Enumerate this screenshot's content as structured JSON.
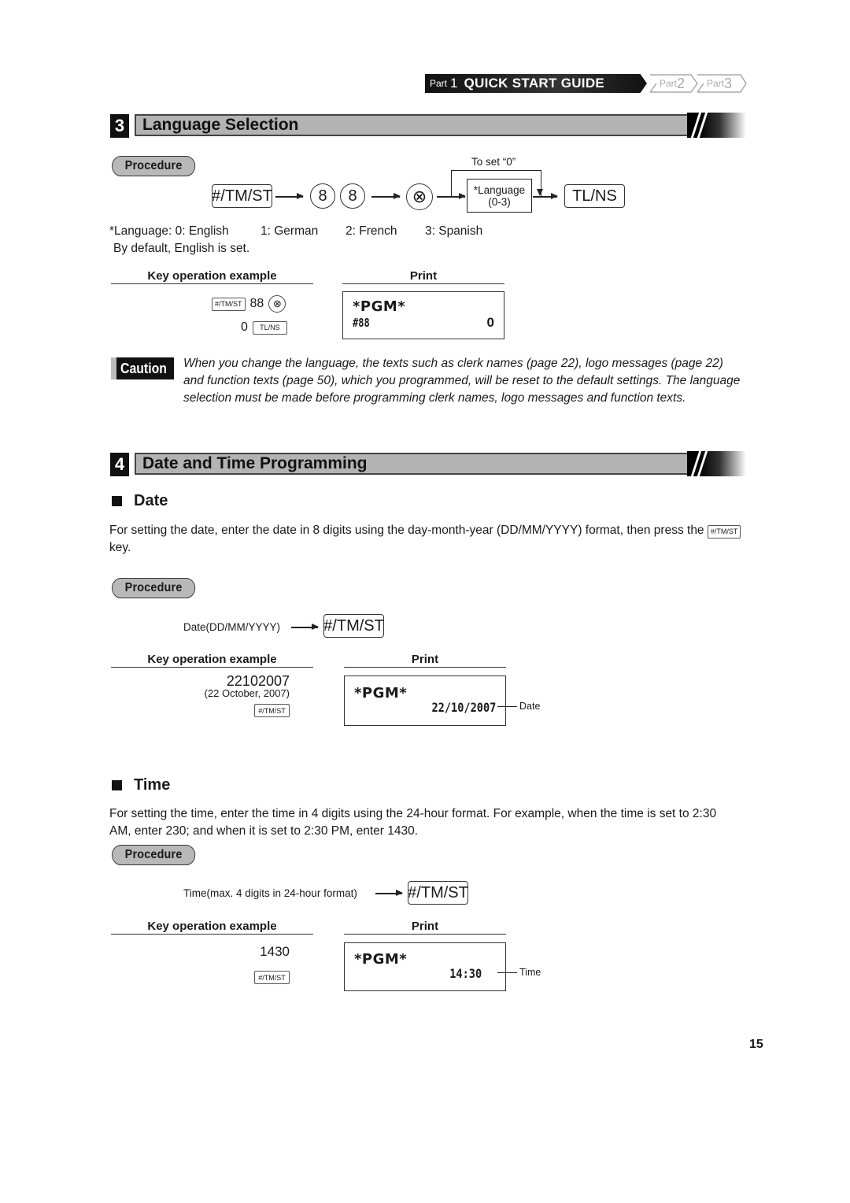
{
  "header": {
    "part1_prefix": "Part",
    "part1_num": "1",
    "part1_title": "QUICK START GUIDE",
    "part2_prefix": "Part",
    "part2_num": "2",
    "part3_prefix": "Part",
    "part3_num": "3"
  },
  "section3": {
    "number": "3",
    "title": "Language Selection",
    "procedure_label": "Procedure",
    "flow": {
      "key1": "#/TM/ST",
      "digit1": "8",
      "digit2": "8",
      "multiply_key": "⊗",
      "to_set_label": "To set “0”",
      "language_box_line1": "*Language",
      "language_box_line2": "(0-3)",
      "final_key": "TL/NS"
    },
    "language_options": [
      "*Language: 0: English",
      "1: German",
      "2: French",
      "3: Spanish"
    ],
    "default_note": "By default, English is set.",
    "key_op_header": "Key operation example",
    "print_header": "Print",
    "key_op": {
      "line1_key": "#/TM/ST",
      "line1_digits": "88",
      "line1_mult": "⊗",
      "line2_digit": "0",
      "line2_key": "TL/NS"
    },
    "print": {
      "pgm": "*PGM*",
      "code": "#88",
      "value": "0"
    },
    "caution_label": "Caution",
    "caution_text": "When you change the language, the texts such as clerk names (page 22), logo messages (page 22) and function texts (page 50), which you programmed, will be reset to the default settings.  The language selection must be made before programming clerk names, logo messages and function texts."
  },
  "section4": {
    "number": "4",
    "title": "Date and Time Programming",
    "date": {
      "title": "Date",
      "description": "For setting the date, enter the date in 8 digits using the day-month-year (DD/MM/YYYY) format, then press the",
      "description_key": "#/TM/ST",
      "description_end": "key.",
      "procedure_label": "Procedure",
      "flow_label": "Date(DD/MM/YYYY)",
      "flow_key": "#/TM/ST",
      "key_op_header": "Key operation example",
      "print_header": "Print",
      "example_value": "22102007",
      "example_note": "(22 October, 2007)",
      "example_key": "#/TM/ST",
      "print_pgm": "*PGM*",
      "print_value": "22/10/2007",
      "print_callout": "Date"
    },
    "time": {
      "title": "Time",
      "description": "For setting the time, enter the time in 4 digits using the 24-hour format.  For example, when the time is set to 2:30 AM, enter 230; and when it is set to 2:30 PM, enter 1430.",
      "procedure_label": "Procedure",
      "flow_label": "Time(max. 4 digits in 24-hour format)",
      "flow_key": "#/TM/ST",
      "key_op_header": "Key operation example",
      "print_header": "Print",
      "example_value": "1430",
      "example_key": "#/TM/ST",
      "print_pgm": "*PGM*",
      "print_value": "14:30",
      "print_callout": "Time"
    }
  },
  "footer": {
    "page_number": "15"
  }
}
